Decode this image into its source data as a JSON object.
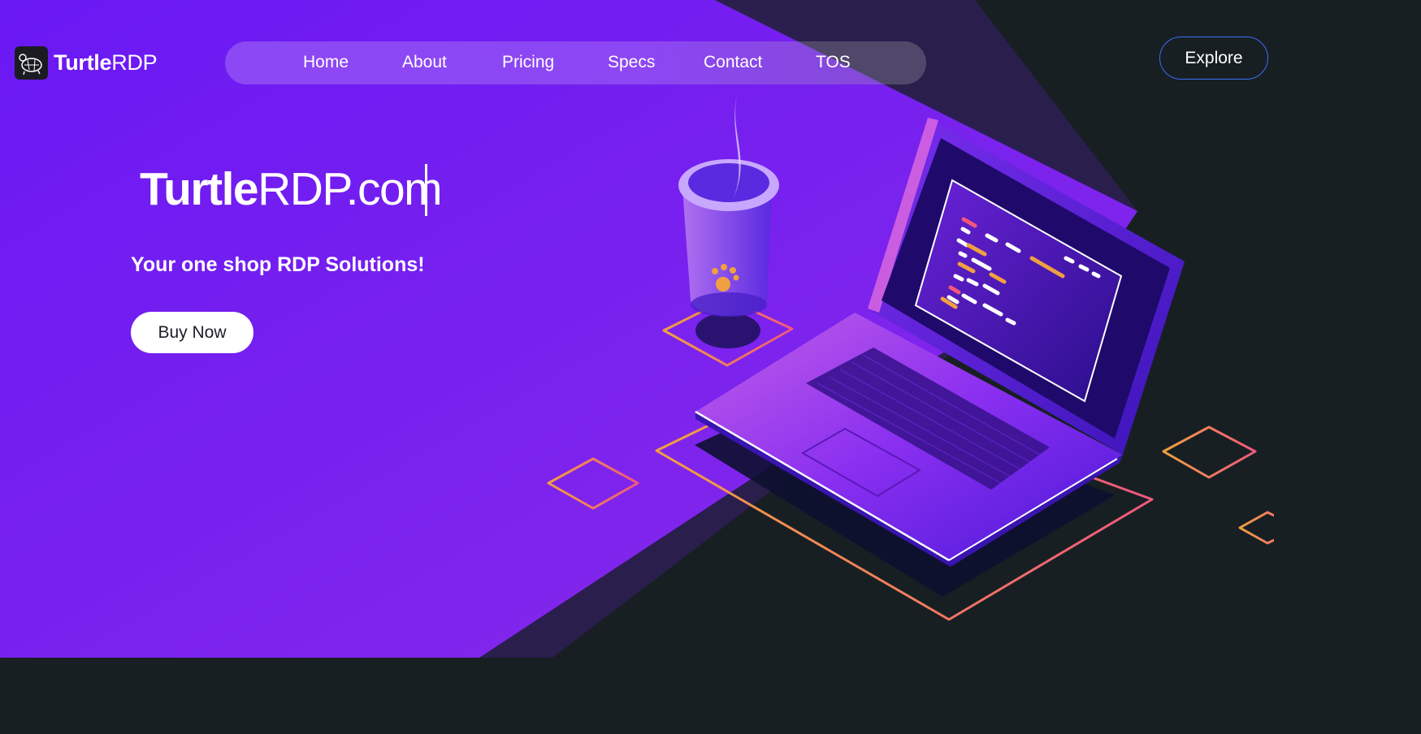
{
  "brand": {
    "bold": "Turtle",
    "light": "RDP",
    "logo_icon": "turtle-logo-icon"
  },
  "nav": {
    "items": [
      {
        "label": "Home"
      },
      {
        "label": "About"
      },
      {
        "label": "Pricing"
      },
      {
        "label": "Specs"
      },
      {
        "label": "Contact"
      },
      {
        "label": "TOS"
      }
    ]
  },
  "header": {
    "explore_label": "Explore"
  },
  "hero": {
    "title_bold": "Turtle",
    "title_light": "RDP.com",
    "subtitle": "Your one shop RDP Solutions!",
    "cta_label": "Buy Now"
  },
  "colors": {
    "purple_background": "#6a1cf3",
    "dark_background": "#171f23",
    "accent_orange": "#f0a040",
    "accent_pink": "#f0587c",
    "explore_border": "#3b6ff5"
  }
}
